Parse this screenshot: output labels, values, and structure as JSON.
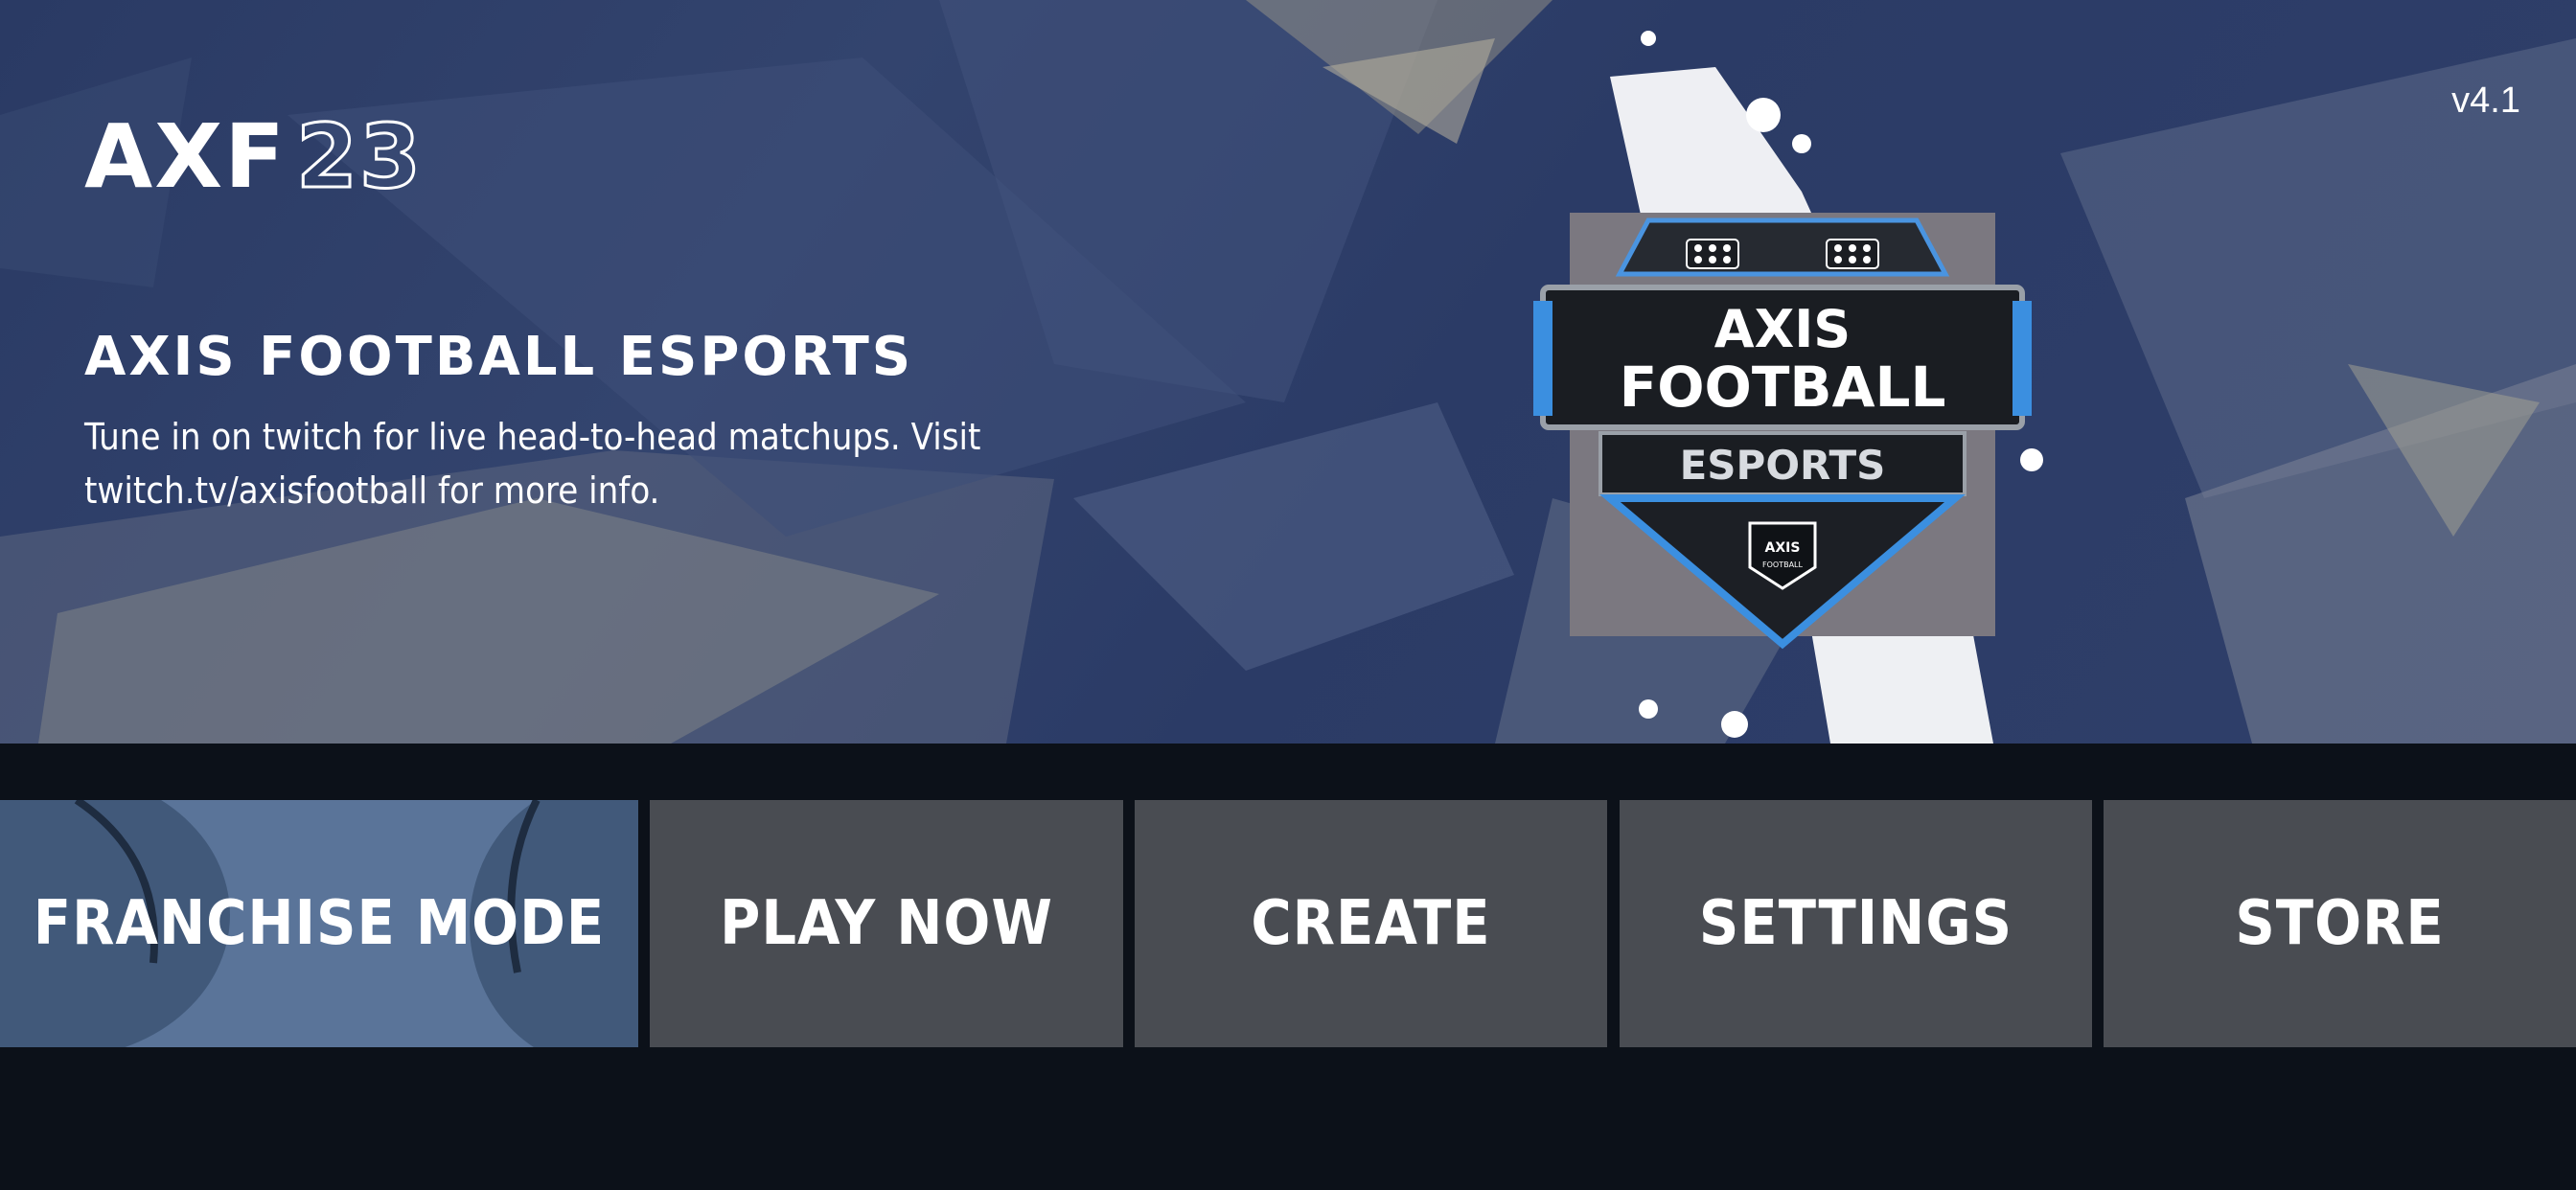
{
  "brand": {
    "logo_letters": "AXF",
    "logo_number": "23"
  },
  "version": "v4.1",
  "promo": {
    "title": "AXIS FOOTBALL ESPORTS",
    "description": "Tune in on twitch for live head-to-head matchups. Visit twitch.tv/axisfootball for more info.",
    "badge_line1": "AXIS",
    "badge_line2": "FOOTBALL",
    "badge_line3": "ESPORTS",
    "badge_small_1": "AXIS",
    "badge_small_2": "FOOTBALL"
  },
  "menu": {
    "items": [
      {
        "label": "FRANCHISE MODE",
        "selected": true
      },
      {
        "label": "PLAY NOW",
        "selected": false
      },
      {
        "label": "CREATE",
        "selected": false
      },
      {
        "label": "SETTINGS",
        "selected": false
      },
      {
        "label": "STORE",
        "selected": false
      }
    ]
  },
  "colors": {
    "hero_bg": "#2f3f6a",
    "band_bg": "#0c1119",
    "tile_bg": "#494c52",
    "tile_selected_bg": "#5a7499",
    "accent_blue": "#3b8fe0"
  }
}
